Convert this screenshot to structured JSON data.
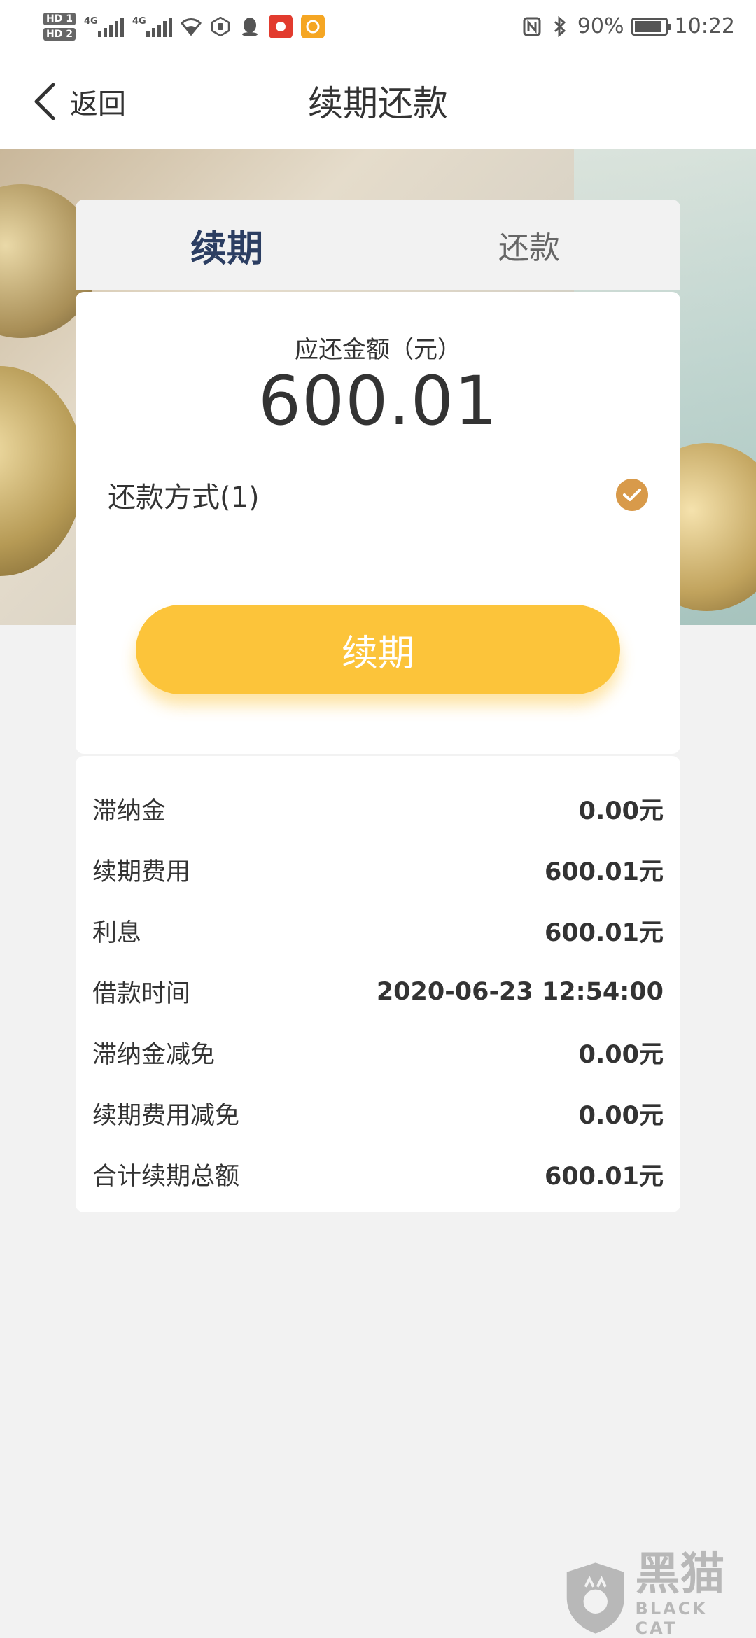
{
  "status_bar": {
    "hd1": "HD 1",
    "hd2": "HD 2",
    "net1": "4G",
    "net2": "4G",
    "battery": "90%",
    "time": "10:22"
  },
  "nav": {
    "back_label": "返回",
    "title": "续期还款"
  },
  "tabs": [
    {
      "label": "续期",
      "active": true
    },
    {
      "label": "还款",
      "active": false
    }
  ],
  "amount": {
    "label": "应还金额（元）",
    "value": "600.01"
  },
  "payment_method": {
    "label": "还款方式(1)",
    "selected": true
  },
  "cta_label": "续期",
  "details": [
    {
      "key": "滞纳金",
      "value": "0.00元"
    },
    {
      "key": "续期费用",
      "value": "600.01元"
    },
    {
      "key": "利息",
      "value": "600.01元"
    },
    {
      "key": "借款时间",
      "value": "2020-06-23 12:54:00"
    },
    {
      "key": "滞纳金减免",
      "value": "0.00元"
    },
    {
      "key": "续期费用减免",
      "value": "0.00元"
    },
    {
      "key": "合计续期总额",
      "value": "600.01元"
    }
  ],
  "watermark": {
    "cn": "黑猫",
    "en": "BLACK CAT"
  },
  "colors": {
    "accent": "#fcc43a",
    "tab_active": "#2c3e62",
    "check": "#d89a4a"
  }
}
